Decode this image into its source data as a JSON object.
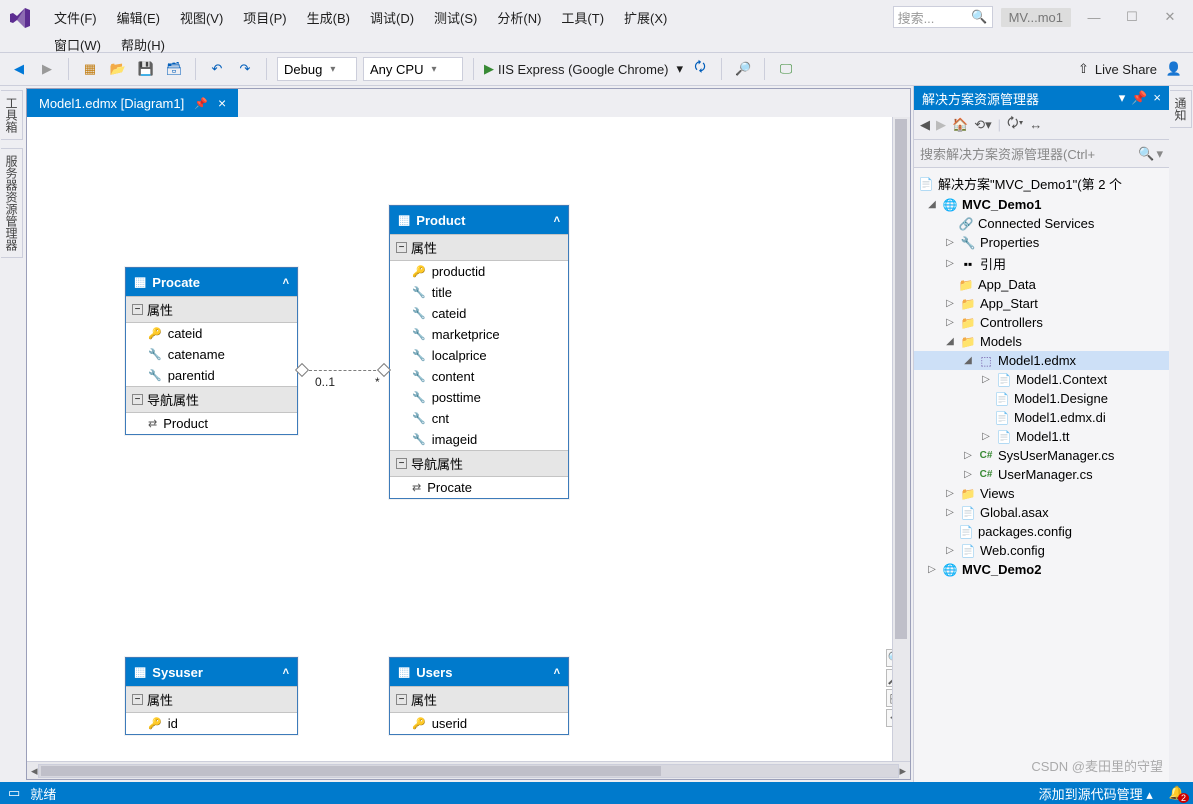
{
  "menu": {
    "file": "文件(F)",
    "edit": "编辑(E)",
    "view": "视图(V)",
    "project": "项目(P)",
    "build": "生成(B)",
    "debug": "调试(D)",
    "test": "测试(S)",
    "analyze": "分析(N)",
    "tools": "工具(T)",
    "extensions": "扩展(X)",
    "window": "窗口(W)",
    "help": "帮助(H)"
  },
  "header": {
    "search_placeholder": "搜索...",
    "doc_pill": "MV...mo1",
    "live_share": "Live Share"
  },
  "toolbar": {
    "config": "Debug",
    "platform": "Any CPU",
    "run": "IIS Express (Google Chrome)"
  },
  "side": {
    "toolbox": "工具箱",
    "server": "服务器资源管理器",
    "notify": "通知"
  },
  "editor": {
    "tab": "Model1.edmx [Diagram1]"
  },
  "diagram": {
    "section_props": "属性",
    "section_nav": "导航属性",
    "procate": {
      "title": "Procate",
      "props": [
        "cateid",
        "catename",
        "parentid"
      ],
      "nav": [
        "Product"
      ]
    },
    "product": {
      "title": "Product",
      "props": [
        "productid",
        "title",
        "cateid",
        "marketprice",
        "localprice",
        "content",
        "posttime",
        "cnt",
        "imageid"
      ],
      "nav": [
        "Procate"
      ]
    },
    "sysuser": {
      "title": "Sysuser",
      "props": [
        "id"
      ]
    },
    "users": {
      "title": "Users",
      "props": [
        "userid"
      ]
    },
    "rel": {
      "left": "0..1",
      "right": "*"
    }
  },
  "solution": {
    "title": "解决方案资源管理器",
    "search_placeholder": "搜索解决方案资源管理器(Ctrl+",
    "root": "解决方案\"MVC_Demo1\"(第 2 个",
    "proj1": "MVC_Demo1",
    "items": {
      "connected": "Connected Services",
      "properties": "Properties",
      "refs": "引用",
      "appdata": "App_Data",
      "appstart": "App_Start",
      "controllers": "Controllers",
      "models": "Models",
      "model1": "Model1.edmx",
      "context": "Model1.Context",
      "designer": "Model1.Designe",
      "diagram": "Model1.edmx.di",
      "tt": "Model1.tt",
      "sysuser": "SysUserManager.cs",
      "usermgr": "UserManager.cs",
      "views": "Views",
      "global": "Global.asax",
      "packages": "packages.config",
      "webconfig": "Web.config"
    },
    "proj2": "MVC_Demo2"
  },
  "status": {
    "ready": "就绪",
    "source": "添加到源代码管理",
    "watermark": "CSDN @麦田里的守望"
  }
}
